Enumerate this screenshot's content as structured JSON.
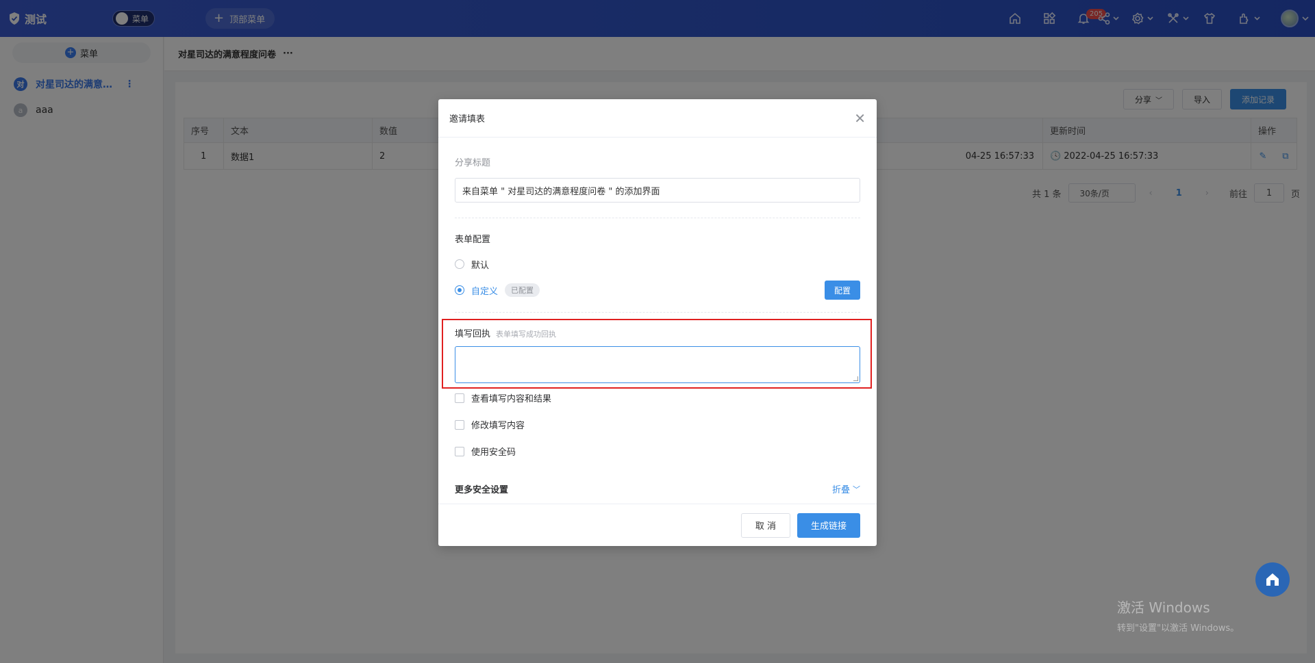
{
  "topbar": {
    "brand": "测试",
    "toggle_label": "菜单",
    "top_menu_label": "顶部菜单",
    "notification_count": "205"
  },
  "sidebar": {
    "add_label": "菜单",
    "items": [
      {
        "avatar": "对",
        "label": "对星司达的满意…",
        "active": true
      },
      {
        "avatar": "a",
        "label": "aaa",
        "active": false
      }
    ]
  },
  "breadcrumb": {
    "title": "对星司达的满意程度问卷",
    "more": "···"
  },
  "toolbar": {
    "share_label": "分享",
    "import_label": "导入",
    "add_label": "添加记录"
  },
  "table": {
    "headers": {
      "index": "序号",
      "text": "文本",
      "number": "数值",
      "updated": "更新时间",
      "actions": "操作"
    },
    "row": {
      "index": "1",
      "text": "数据1",
      "number": "2",
      "created_partial": "04-25 16:57:33",
      "updated": "2022-04-25 16:57:33"
    }
  },
  "pager": {
    "total": "共 1 条",
    "page_size": "30条/页",
    "current": "1",
    "goto_label": "前往",
    "goto_value": "1",
    "page_unit": "页"
  },
  "dialog": {
    "title": "邀请填表",
    "share_title_label": "分享标题",
    "share_title_value": "来自菜单 \" 对星司达的满意程度问卷 \" 的添加界面",
    "form_config_title": "表单配置",
    "option_default": "默认",
    "option_custom": "自定义",
    "configured_tag": "已配置",
    "config_button": "配置",
    "echo_label": "填写回执",
    "echo_hint": "表单填写成功回执",
    "check_view": "查看填写内容和结果",
    "check_modify": "修改填写内容",
    "check_security": "使用安全码",
    "more_security": "更多安全设置",
    "collapse_label": "折叠",
    "cancel_button": "取 消",
    "generate_button": "生成链接"
  },
  "watermark": {
    "line1": "激活 Windows",
    "line2": "转到\"设置\"以激活 Windows。"
  },
  "colors": {
    "primary": "#3a8ee6",
    "topbar": "#2f55c8",
    "highlight": "#e02020"
  }
}
